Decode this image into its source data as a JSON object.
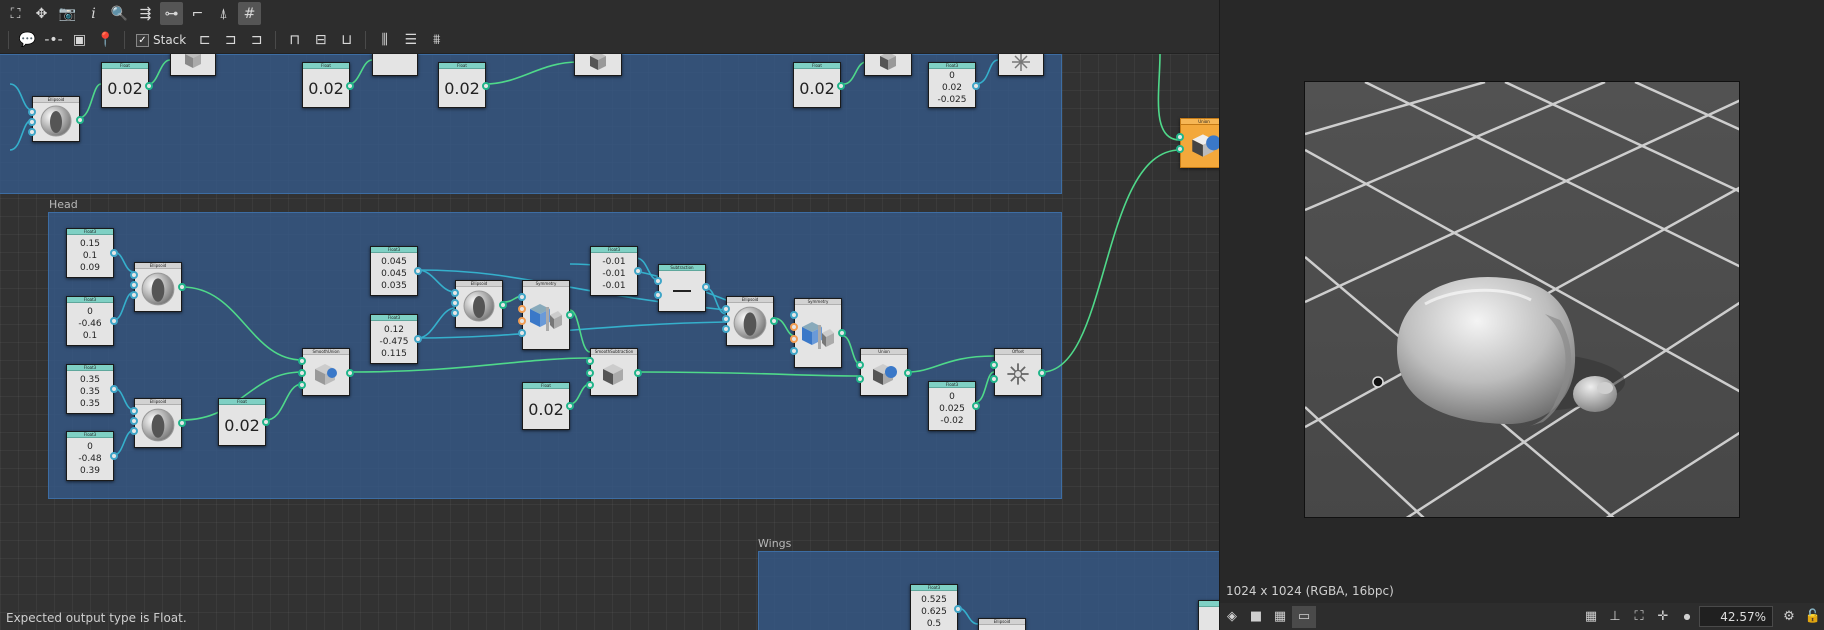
{
  "toolbar": {
    "stack_label": "Stack"
  },
  "frames": {
    "head": "Head",
    "wings": "Wings"
  },
  "nodes": {
    "float_top_1": "0.02",
    "float_top_2": "0.02",
    "float_top_3": "0.02",
    "float_top_4": "0.02",
    "float3_top": [
      "0",
      "0.02",
      "-0.025"
    ],
    "head_f3_a": [
      "0.15",
      "0.1",
      "0.09"
    ],
    "head_f3_b": [
      "0",
      "-0.46",
      "0.1"
    ],
    "head_f3_c": [
      "0.35",
      "0.35",
      "0.35"
    ],
    "head_f3_d": [
      "0",
      "-0.48",
      "0.39"
    ],
    "head_float_blend": "0.02",
    "head_f3_e": [
      "0.045",
      "0.045",
      "0.035"
    ],
    "head_f3_f": [
      "0.12",
      "-0.475",
      "0.115"
    ],
    "head_f3_g": [
      "-0.01",
      "-0.01",
      "-0.01"
    ],
    "head_float_sub": "0.02",
    "head_f3_h": [
      "0",
      "0.025",
      "-0.02"
    ],
    "wings_f3_a": [
      "0.525",
      "0.625",
      "0.5"
    ]
  },
  "status": {
    "message": "Expected output type is Float."
  },
  "viewer": {
    "resolution": "1024 x 1024 (RGBA, 16bpc)",
    "zoom": "42.57%"
  }
}
